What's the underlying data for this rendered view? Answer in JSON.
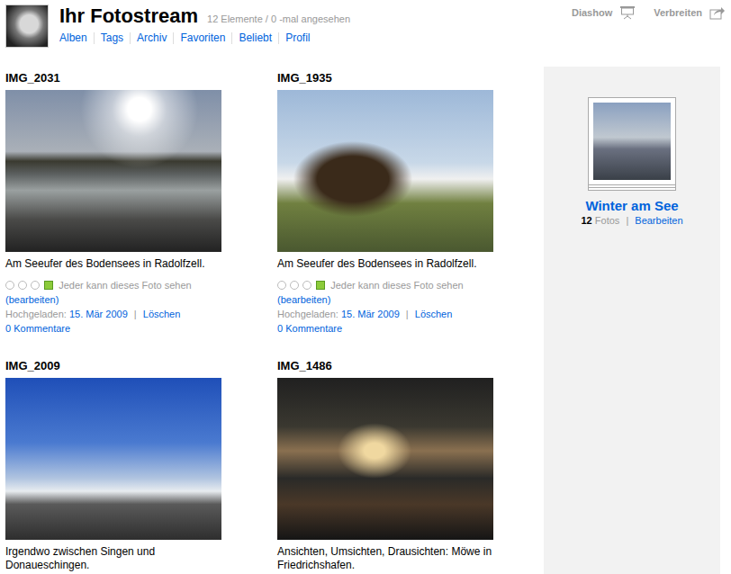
{
  "header": {
    "title": "Ihr Fotostream",
    "stats": "12 Elemente / 0 -mal angesehen",
    "nav": [
      "Alben",
      "Tags",
      "Archiv",
      "Favoriten",
      "Beliebt",
      "Profil"
    ],
    "actions": [
      {
        "label": "Diashow"
      },
      {
        "label": "Verbreiten"
      }
    ]
  },
  "photos": [
    {
      "title": "IMG_2031",
      "caption": "Am Seeufer des Bodensees in Radolfzell.",
      "details": true,
      "privacy": "Jeder kann dieses Foto sehen",
      "edit": "(bearbeiten)",
      "uploaded_label": "Hochgeladen:",
      "uploaded_date": "15. Mär 2009",
      "delete": "Löschen",
      "comments": "0 Kommentare"
    },
    {
      "title": "IMG_1935",
      "caption": "Am Seeufer des Bodensees in Radolfzell.",
      "details": true,
      "privacy": "Jeder kann dieses Foto sehen",
      "edit": "(bearbeiten)",
      "uploaded_label": "Hochgeladen:",
      "uploaded_date": "15. Mär 2009",
      "delete": "Löschen",
      "comments": "0 Kommentare"
    },
    {
      "title": "IMG_2009",
      "caption": "Irgendwo zwischen Singen und Donaueschingen.",
      "details": false
    },
    {
      "title": "IMG_1486",
      "caption": "Ansichten, Umsichten, Drausichten: Möwe in Friedrichshafen.",
      "details": false
    }
  ],
  "set": {
    "title": "Winter am See",
    "count": "12",
    "count_label": "Fotos",
    "edit": "Bearbeiten"
  }
}
